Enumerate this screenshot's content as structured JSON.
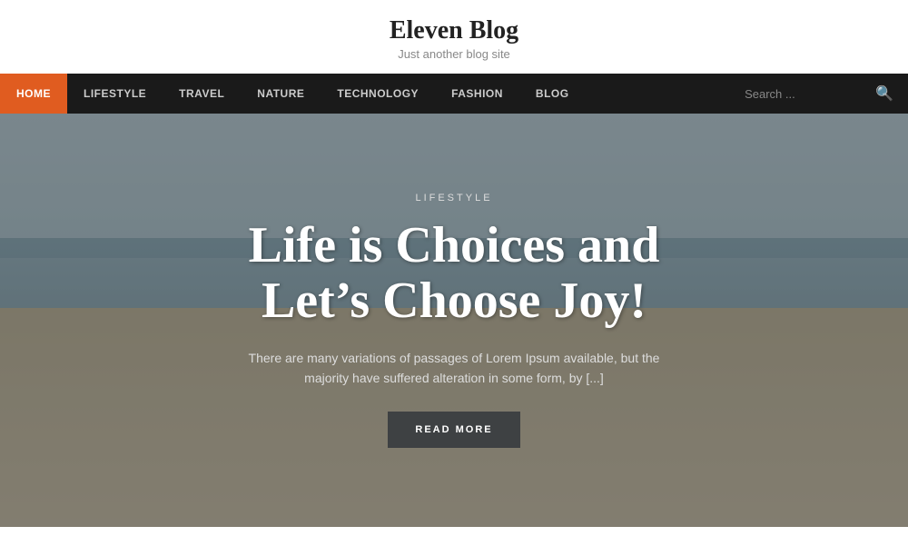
{
  "header": {
    "site_title": "Eleven Blog",
    "site_tagline": "Just another blog site"
  },
  "navbar": {
    "items": [
      {
        "label": "HOME",
        "active": true
      },
      {
        "label": "LIFESTYLE",
        "active": false
      },
      {
        "label": "TRAVEL",
        "active": false
      },
      {
        "label": "NATURE",
        "active": false
      },
      {
        "label": "TECHNOLOGY",
        "active": false
      },
      {
        "label": "FASHION",
        "active": false
      },
      {
        "label": "BLOG",
        "active": false
      }
    ],
    "search_placeholder": "Search ..."
  },
  "hero": {
    "category": "LIFESTYLE",
    "title": "Life is Choices and Let’s Choose Joy!",
    "excerpt": "There are many variations of passages of Lorem Ipsum available, but the majority have suffered alteration in some form, by [...]",
    "read_more_label": "READ MORE"
  }
}
